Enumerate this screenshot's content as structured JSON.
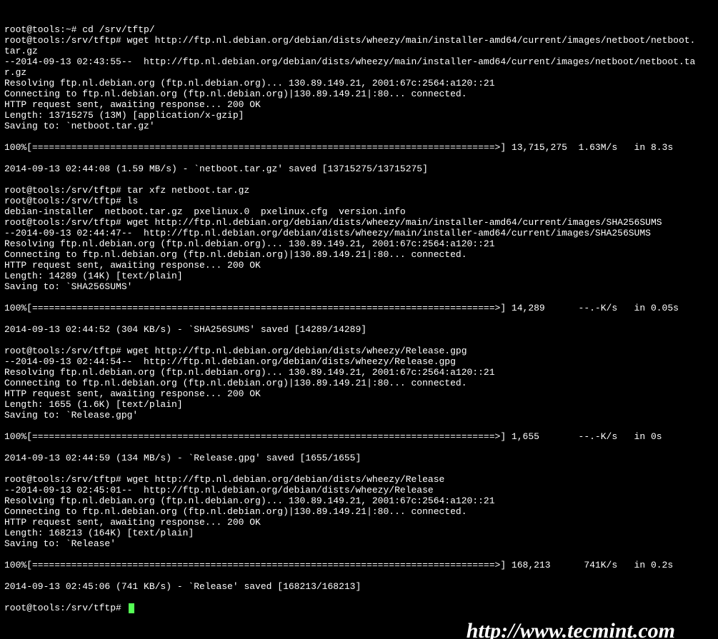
{
  "terminal": {
    "lines": [
      "root@tools:~# cd /srv/tftp/",
      "root@tools:/srv/tftp# wget http://ftp.nl.debian.org/debian/dists/wheezy/main/installer-amd64/current/images/netboot/netboot.",
      "tar.gz",
      "--2014-09-13 02:43:55--  http://ftp.nl.debian.org/debian/dists/wheezy/main/installer-amd64/current/images/netboot/netboot.ta",
      "r.gz",
      "Resolving ftp.nl.debian.org (ftp.nl.debian.org)... 130.89.149.21, 2001:67c:2564:a120::21",
      "Connecting to ftp.nl.debian.org (ftp.nl.debian.org)|130.89.149.21|:80... connected.",
      "HTTP request sent, awaiting response... 200 OK",
      "Length: 13715275 (13M) [application/x-gzip]",
      "Saving to: `netboot.tar.gz'",
      "",
      "100%[===================================================================================>] 13,715,275  1.63M/s   in 8.3s",
      "",
      "2014-09-13 02:44:08 (1.59 MB/s) - `netboot.tar.gz' saved [13715275/13715275]",
      "",
      "root@tools:/srv/tftp# tar xfz netboot.tar.gz",
      "root@tools:/srv/tftp# ls",
      "debian-installer  netboot.tar.gz  pxelinux.0  pxelinux.cfg  version.info",
      "root@tools:/srv/tftp# wget http://ftp.nl.debian.org/debian/dists/wheezy/main/installer-amd64/current/images/SHA256SUMS",
      "--2014-09-13 02:44:47--  http://ftp.nl.debian.org/debian/dists/wheezy/main/installer-amd64/current/images/SHA256SUMS",
      "Resolving ftp.nl.debian.org (ftp.nl.debian.org)... 130.89.149.21, 2001:67c:2564:a120::21",
      "Connecting to ftp.nl.debian.org (ftp.nl.debian.org)|130.89.149.21|:80... connected.",
      "HTTP request sent, awaiting response... 200 OK",
      "Length: 14289 (14K) [text/plain]",
      "Saving to: `SHA256SUMS'",
      "",
      "100%[===================================================================================>] 14,289      --.-K/s   in 0.05s",
      "",
      "2014-09-13 02:44:52 (304 KB/s) - `SHA256SUMS' saved [14289/14289]",
      "",
      "root@tools:/srv/tftp# wget http://ftp.nl.debian.org/debian/dists/wheezy/Release.gpg",
      "--2014-09-13 02:44:54--  http://ftp.nl.debian.org/debian/dists/wheezy/Release.gpg",
      "Resolving ftp.nl.debian.org (ftp.nl.debian.org)... 130.89.149.21, 2001:67c:2564:a120::21",
      "Connecting to ftp.nl.debian.org (ftp.nl.debian.org)|130.89.149.21|:80... connected.",
      "HTTP request sent, awaiting response... 200 OK",
      "Length: 1655 (1.6K) [text/plain]",
      "Saving to: `Release.gpg'",
      "",
      "100%[===================================================================================>] 1,655       --.-K/s   in 0s",
      "",
      "2014-09-13 02:44:59 (134 MB/s) - `Release.gpg' saved [1655/1655]",
      "",
      "root@tools:/srv/tftp# wget http://ftp.nl.debian.org/debian/dists/wheezy/Release",
      "--2014-09-13 02:45:01--  http://ftp.nl.debian.org/debian/dists/wheezy/Release",
      "Resolving ftp.nl.debian.org (ftp.nl.debian.org)... 130.89.149.21, 2001:67c:2564:a120::21",
      "Connecting to ftp.nl.debian.org (ftp.nl.debian.org)|130.89.149.21|:80... connected.",
      "HTTP request sent, awaiting response... 200 OK",
      "Length: 168213 (164K) [text/plain]",
      "Saving to: `Release'",
      "",
      "100%[===================================================================================>] 168,213      741K/s   in 0.2s",
      "",
      "2014-09-13 02:45:06 (741 KB/s) - `Release' saved [168213/168213]",
      "",
      "root@tools:/srv/tftp# "
    ],
    "prompt_final": "root@tools:/srv/tftp# "
  },
  "watermark": "http://www.tecmint.com"
}
